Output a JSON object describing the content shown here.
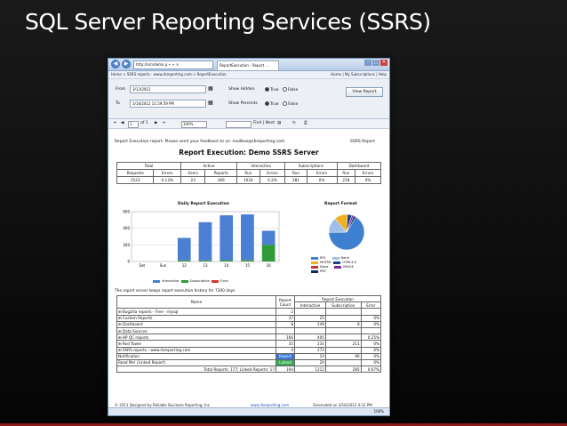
{
  "slide": {
    "title": "SQL Server Reporting Services (SSRS)"
  },
  "browser": {
    "url": "http://ssrsdemo",
    "url_suffix": "ρ • → ×",
    "tab": "ReportExecution - Report ...",
    "buttons": {
      "back": "◀",
      "forward": "▶",
      "min": "–",
      "max": "□",
      "close": "✕"
    }
  },
  "breadcrumb": {
    "path": "Home > SSRS reports - www.rbreporting.com > ReportExecution",
    "links": "Home | My Subscriptions | Help"
  },
  "params": {
    "from_label": "From",
    "from_value": "3/13/2012",
    "to_label": "To",
    "to_value": "3/16/2012 11:59:59 PM",
    "hidden_label": "Show Hidden",
    "percents_label": "Show Percents",
    "true_label": "True",
    "false_label": "False",
    "view_report": "View Report"
  },
  "toolbar": {
    "page": "1",
    "of": "of 1",
    "zoom": "100%",
    "find": "Find | Next",
    "first": "⇤",
    "prev": "◀",
    "next": "▶",
    "last": "⇥",
    "refresh": "↻",
    "export": "▤",
    "print": "⎙"
  },
  "report": {
    "note": "Report Execution report. Please send your feedback to us: mailbox@rbreporting.com",
    "ssrs_label": "SSRS Report",
    "title": "Report Execution: Demo SSRS Server",
    "summary": {
      "groups": [
        "Total",
        "Active",
        "Interactive",
        "Subscriptions",
        "Dashboard"
      ],
      "cols": [
        "Requests",
        "Errors",
        "Users",
        "Reports",
        "Run",
        "Errors",
        "Run",
        "Errors",
        "Run",
        "Errors"
      ],
      "values": [
        "1523",
        "0.13%",
        "23",
        "166",
        "1024",
        "0.2%",
        "281",
        "0%",
        "218",
        "0%"
      ]
    },
    "daily_title": "Daily Report Execution",
    "format_title": "Report Format",
    "daily_legend": [
      "Interactive",
      "Subscription",
      "Error"
    ],
    "format_legend": [
      "RPL",
      "None",
      "MHTML",
      "HTML4.0",
      "None",
      "IMAGE",
      "PDF"
    ],
    "history_note": "The report server keeps report execution history for 7300 days",
    "detail": {
      "name_header": "Name",
      "report_count_header": "Report Count",
      "report_exec_header": "Report Execution",
      "sub_headers": [
        "Interactive",
        "Subscription",
        "Error"
      ],
      "rows": [
        {
          "name": "⊞ Bugzilla reports - Free - mysql",
          "count": "2",
          "interactive": "",
          "subscription": "",
          "error": ""
        },
        {
          "name": "⊞ Custom Reports",
          "count": "37",
          "interactive": "25",
          "subscription": "",
          "error": "0%"
        },
        {
          "name": "⊞ Dashboard",
          "count": "8",
          "interactive": "249",
          "subscription": "8",
          "error": "0%"
        },
        {
          "name": "⊞ Data Sources",
          "count": "",
          "interactive": "",
          "subscription": "",
          "error": ""
        },
        {
          "name": "⊞ HP QC reports",
          "count": "166",
          "interactive": "405",
          "subscription": "",
          "error": "0.25%"
        },
        {
          "name": "⊞ Red Tower",
          "count": "35",
          "interactive": "231",
          "subscription": "211",
          "error": "0%"
        },
        {
          "name": "⊞ SSRS reports - www.rbreporting.com",
          "count": "4",
          "interactive": "272",
          "subscription": "",
          "error": "0%"
        },
        {
          "name": "Notification",
          "count": "Report",
          "interactive": "10",
          "subscription": "66",
          "error": "0%"
        },
        {
          "name": "Read Me! (Linked Report)",
          "count": "Linked",
          "interactive": "20",
          "subscription": "",
          "error": "0%"
        }
      ],
      "total_label": "Total Reports: 177; Linked Reports: 17",
      "total": {
        "count": "194",
        "interactive": "1212",
        "subscription": "285",
        "error": "0.07%"
      }
    },
    "footer_left": "© 2011 Designed by Reliable Business Reporting, Inc.",
    "footer_mid": "www.rbreporting.com",
    "footer_right": "Generated on 3/16/2012 4:31 PM"
  },
  "status": {
    "zoom": "100%"
  },
  "chart_data": [
    {
      "type": "bar",
      "title": "Daily Report Execution",
      "categories": [
        "Sat",
        "Sun",
        "12",
        "13",
        "14",
        "15",
        "16"
      ],
      "ylim": [
        0,
        600
      ],
      "yticks": [
        "600",
        "400",
        "200",
        "0"
      ],
      "series": [
        {
          "name": "Interactive",
          "color": "#4a7fd4",
          "values": [
            0,
            0,
            270,
            460,
            540,
            550,
            170
          ]
        },
        {
          "name": "Subscription",
          "color": "#2e9a3a",
          "values": [
            0,
            0,
            12,
            12,
            15,
            15,
            200
          ]
        },
        {
          "name": "Error",
          "color": "#d23a2a",
          "values": [
            0,
            0,
            2,
            1,
            1,
            2,
            0
          ]
        }
      ]
    },
    {
      "type": "pie",
      "title": "Report Format",
      "labels": [
        "RPL",
        "None",
        "MHTML",
        "HTML4.0",
        "IMAGE",
        "PDF"
      ],
      "colors": [
        "#3f7fd0",
        "#9ebfe8",
        "#f0b020",
        "#1e3f8a",
        "#7b2aa0",
        "#0d2a5a"
      ],
      "values": [
        66,
        14,
        12,
        4,
        2,
        2
      ]
    }
  ]
}
